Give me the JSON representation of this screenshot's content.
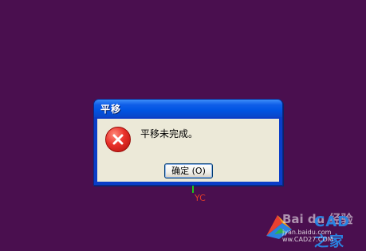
{
  "dialog": {
    "title": "平移",
    "message": "平移未完成。",
    "icon": "error-icon",
    "ok_label": "确定 (O)"
  },
  "axis": {
    "label": "YC"
  },
  "watermark": {
    "brand": "Bai du 经验",
    "site": "CAD之家",
    "url": "jyan.baidu.com  ww.CAD27.COM"
  },
  "colors": {
    "background": "#4a0f4f",
    "title_bar": "#0054e3",
    "dialog_body": "#ece9d8",
    "error_red": "#e8302a"
  }
}
